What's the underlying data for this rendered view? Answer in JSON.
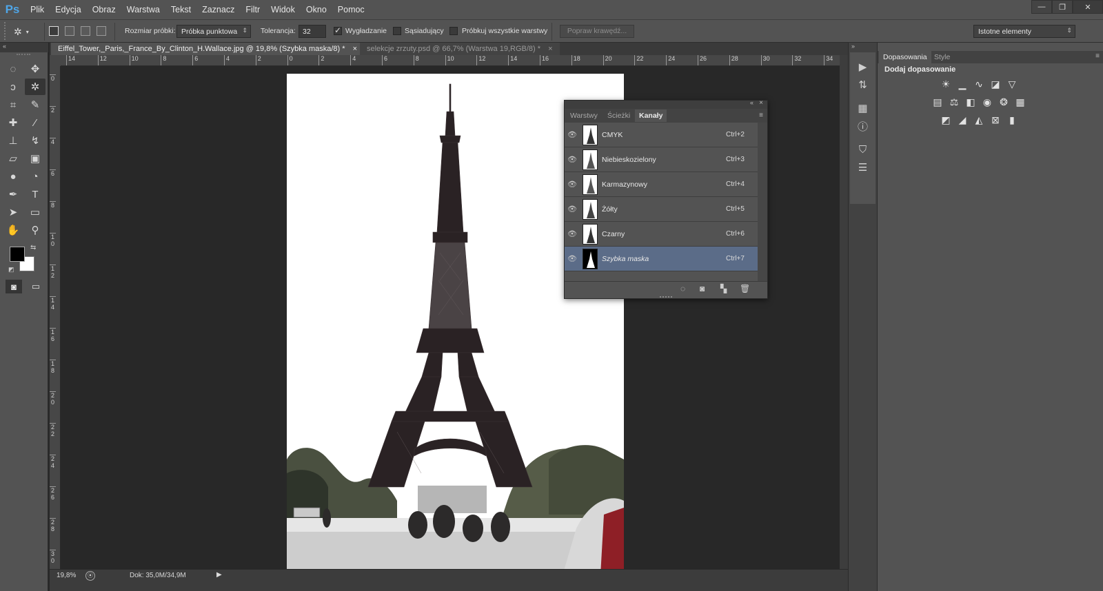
{
  "app": {
    "logo": "Ps"
  },
  "menu": [
    "Plik",
    "Edycja",
    "Obraz",
    "Warstwa",
    "Tekst",
    "Zaznacz",
    "Filtr",
    "Widok",
    "Okno",
    "Pomoc"
  ],
  "window_controls": {
    "minimize": "—",
    "restore": "❐",
    "close": "✕"
  },
  "options": {
    "sample_size_label": "Rozmiar próbki:",
    "sample_size_value": "Próbka punktowa",
    "tolerance_label": "Tolerancja:",
    "tolerance_value": "32",
    "antialias_label": "Wygładzanie",
    "contiguous_label": "Sąsiadujący",
    "sample_all_label": "Próbkuj wszystkie warstwy",
    "refine_edge_label": "Popraw krawędź...",
    "workspace_value": "Istotne elementy"
  },
  "tabs": [
    {
      "label": "Eiffel_Tower,_Paris,_France_By_Clinton_H.Wallace.jpg @ 19,8% (Szybka maska/8) *",
      "close": "×"
    },
    {
      "label": "selekcje zrzuty.psd @ 66,7% (Warstwa 19,RGB/8) *",
      "close": "×"
    }
  ],
  "ruler_h": [
    "14",
    "12",
    "10",
    "8",
    "6",
    "4",
    "2",
    "0",
    "2",
    "4",
    "6",
    "8",
    "10",
    "12",
    "14",
    "16",
    "18",
    "20",
    "22",
    "24",
    "26",
    "28",
    "30",
    "32",
    "34"
  ],
  "ruler_v": [
    "0",
    "2",
    "4",
    "6",
    "8",
    "10",
    "12",
    "14",
    "16",
    "18",
    "20",
    "22",
    "24",
    "26",
    "28",
    "30"
  ],
  "status": {
    "zoom": "19,8%",
    "doc": "Dok: 35,0M/34,9M"
  },
  "channels_panel": {
    "tabs": [
      "Warstwy",
      "Ścieżki",
      "Kanały"
    ],
    "active_tab": 2,
    "channels": [
      {
        "name": "CMYK",
        "shortcut": "Ctrl+2"
      },
      {
        "name": "Niebieskozielony",
        "shortcut": "Ctrl+3"
      },
      {
        "name": "Karmazynowy",
        "shortcut": "Ctrl+4"
      },
      {
        "name": "Żółty",
        "shortcut": "Ctrl+5"
      },
      {
        "name": "Czarny",
        "shortcut": "Ctrl+6"
      },
      {
        "name": "Szybka maska",
        "shortcut": "Ctrl+7"
      }
    ]
  },
  "adjustments_panel": {
    "tabs": [
      "Dopasowania",
      "Style"
    ],
    "title": "Dodaj dopasowanie"
  },
  "colors": {
    "selection": "#5b6c88",
    "panel": "#535353",
    "background": "#282828"
  }
}
